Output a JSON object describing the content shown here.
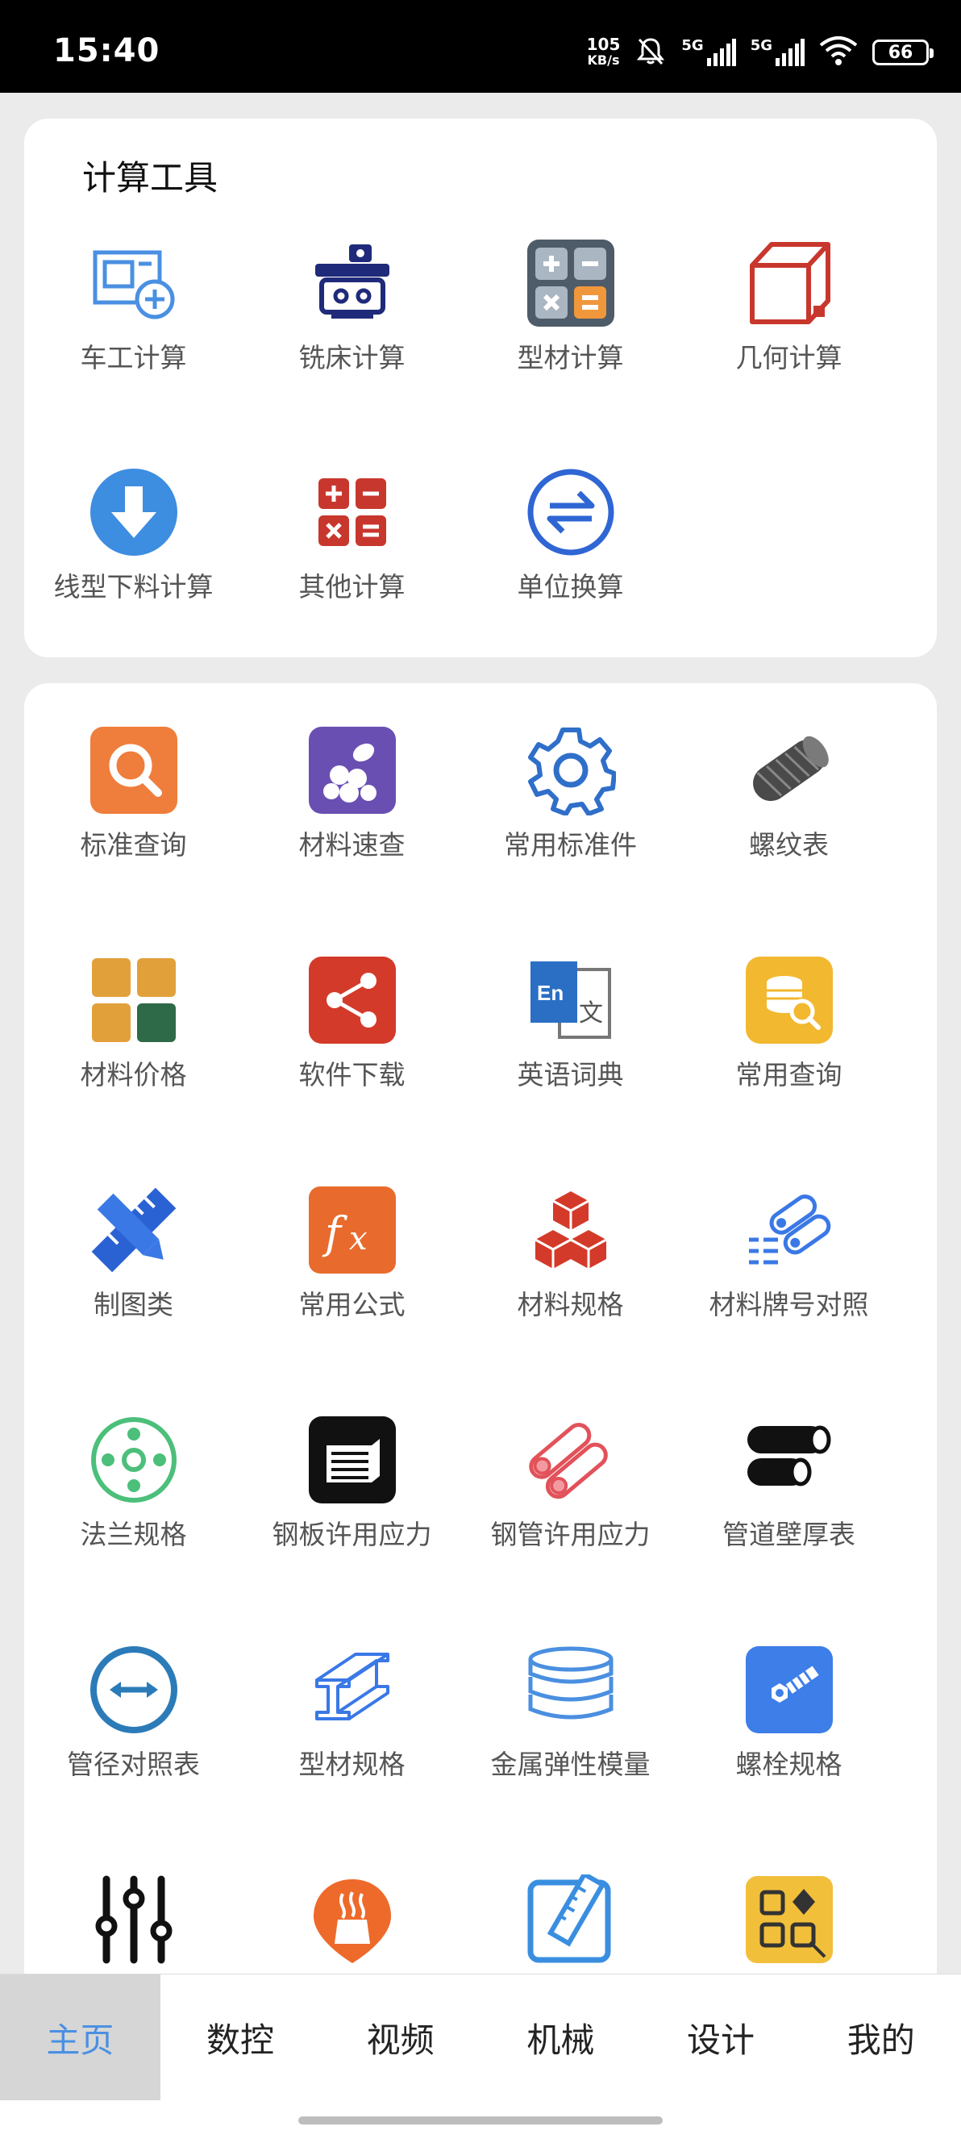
{
  "status_bar": {
    "time": "15:40",
    "net_speed_value": "105",
    "net_speed_unit": "KB/s",
    "sim1_label": "5G",
    "sim2_label": "5G",
    "battery": "66"
  },
  "calc_section": {
    "title": "计算工具",
    "items": [
      {
        "label": "车工计算",
        "icon": "lathe-icon"
      },
      {
        "label": "铣床计算",
        "icon": "milling-machine-icon"
      },
      {
        "label": "型材计算",
        "icon": "calculator-icon"
      },
      {
        "label": "几何计算",
        "icon": "cube-icon"
      },
      {
        "label": "线型下料计算",
        "icon": "download-arrow-icon"
      },
      {
        "label": "其他计算",
        "icon": "math-ops-icon"
      },
      {
        "label": "单位换算",
        "icon": "swap-icon"
      }
    ]
  },
  "tools_section": {
    "items": [
      {
        "label": "标准查询",
        "icon": "search-icon"
      },
      {
        "label": "材料速查",
        "icon": "materials-icon"
      },
      {
        "label": "常用标准件",
        "icon": "gear-icon"
      },
      {
        "label": "螺纹表",
        "icon": "thread-bolt-icon"
      },
      {
        "label": "材料价格",
        "icon": "grid-squares-icon"
      },
      {
        "label": "软件下载",
        "icon": "share-icon"
      },
      {
        "label": "英语词典",
        "icon": "dictionary-icon"
      },
      {
        "label": "常用查询",
        "icon": "database-search-icon"
      },
      {
        "label": "制图类",
        "icon": "pencil-ruler-icon"
      },
      {
        "label": "常用公式",
        "icon": "formula-icon"
      },
      {
        "label": "材料规格",
        "icon": "boxes-icon"
      },
      {
        "label": "材料牌号对照",
        "icon": "pipes-list-icon"
      },
      {
        "label": "法兰规格",
        "icon": "flange-icon"
      },
      {
        "label": "钢板许用应力",
        "icon": "steel-plate-icon"
      },
      {
        "label": "钢管许用应力",
        "icon": "steel-pipe-icon"
      },
      {
        "label": "管道壁厚表",
        "icon": "pipe-wall-icon"
      },
      {
        "label": "管径对照表",
        "icon": "diameter-icon"
      },
      {
        "label": "型材规格",
        "icon": "i-beam-icon"
      },
      {
        "label": "金属弹性模量",
        "icon": "stack-icon"
      },
      {
        "label": "螺栓规格",
        "icon": "bolt-icon"
      },
      {
        "label": "",
        "icon": "sliders-icon"
      },
      {
        "label": "",
        "icon": "boiler-icon"
      },
      {
        "label": "",
        "icon": "edit-ruler-icon"
      },
      {
        "label": "",
        "icon": "apps-icon"
      }
    ]
  },
  "tab_bar": {
    "tabs": [
      {
        "label": "主页",
        "active": true
      },
      {
        "label": "数控",
        "active": false
      },
      {
        "label": "视频",
        "active": false
      },
      {
        "label": "机械",
        "active": false
      },
      {
        "label": "设计",
        "active": false
      },
      {
        "label": "我的",
        "active": false
      }
    ]
  },
  "colors": {
    "accent": "#4a90e2",
    "page_bg": "#ebebeb"
  }
}
